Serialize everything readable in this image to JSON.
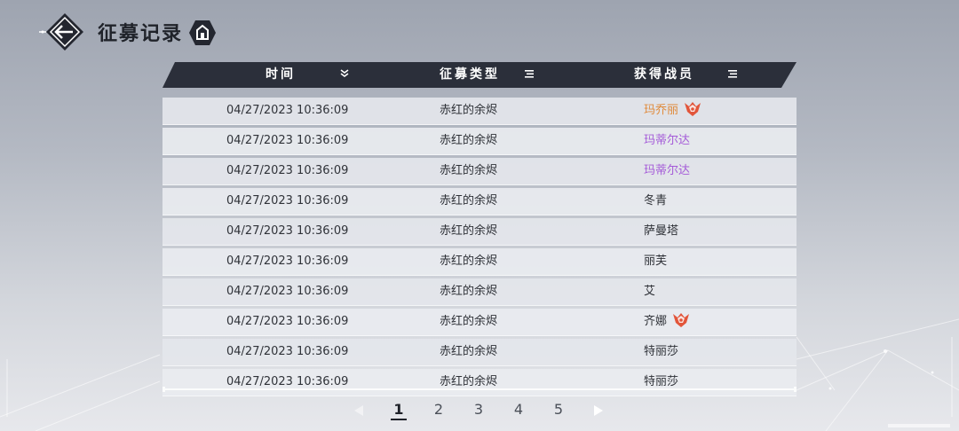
{
  "header": {
    "title": "征募记录",
    "back_icon": "arrow-left-icon",
    "home_icon": "home-icon"
  },
  "table": {
    "columns": [
      {
        "label": "时间",
        "sort_icon": "chevron-double-down-icon"
      },
      {
        "label": "征募类型",
        "sort_icon": "filter-lines-icon"
      },
      {
        "label": "获得战员",
        "sort_icon": "filter-lines-icon"
      }
    ],
    "rows": [
      {
        "time": "04/27/2023 10:36:09",
        "type": "赤红的余烬",
        "character": "玛乔丽",
        "rarity": "orange",
        "badge": true
      },
      {
        "time": "04/27/2023 10:36:09",
        "type": "赤红的余烬",
        "character": "玛蒂尔达",
        "rarity": "purple",
        "badge": false
      },
      {
        "time": "04/27/2023 10:36:09",
        "type": "赤红的余烬",
        "character": "玛蒂尔达",
        "rarity": "purple",
        "badge": false
      },
      {
        "time": "04/27/2023 10:36:09",
        "type": "赤红的余烬",
        "character": "冬青",
        "rarity": "normal",
        "badge": false
      },
      {
        "time": "04/27/2023 10:36:09",
        "type": "赤红的余烬",
        "character": "萨曼塔",
        "rarity": "normal",
        "badge": false
      },
      {
        "time": "04/27/2023 10:36:09",
        "type": "赤红的余烬",
        "character": "丽芙",
        "rarity": "normal",
        "badge": false
      },
      {
        "time": "04/27/2023 10:36:09",
        "type": "赤红的余烬",
        "character": "艾",
        "rarity": "normal",
        "badge": false
      },
      {
        "time": "04/27/2023 10:36:09",
        "type": "赤红的余烬",
        "character": "齐娜",
        "rarity": "normal",
        "badge": true
      },
      {
        "time": "04/27/2023 10:36:09",
        "type": "赤红的余烬",
        "character": "特丽莎",
        "rarity": "normal",
        "badge": false
      },
      {
        "time": "04/27/2023 10:36:09",
        "type": "赤红的余烬",
        "character": "特丽莎",
        "rarity": "normal",
        "badge": false
      }
    ]
  },
  "pagination": {
    "pages": [
      "1",
      "2",
      "3",
      "4",
      "5"
    ],
    "current": "1",
    "prev_icon": "triangle-left-icon",
    "next_icon": "triangle-right-icon"
  },
  "colors": {
    "header_bar": "#2b2f3a",
    "rarity_orange": "#e08a3a",
    "rarity_purple": "#a45ad8",
    "badge": "#e2553a"
  }
}
